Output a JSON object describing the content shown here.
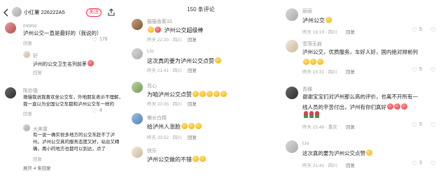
{
  "panel1": {
    "back_icon": "back-arrow-icon",
    "account_name": "小红薯 226222A5",
    "follow_label": "关注",
    "share_icon": "share-icon",
    "comments": [
      {
        "user": "momo",
        "text": "泸州公交一直是最好的（我说的）",
        "meta": "回复",
        "likes": "176"
      },
      {
        "user": "好",
        "text": "泸州的公交卫生名列前茅",
        "meta": "回复",
        "likes": ""
      },
      {
        "user": "陈钞骚",
        "text_lines": [
          "墩慢我说我喜欢坐公交车，外地朋友表示不理解，",
          "我一直以为全国公交车都和泸州公交车一样的"
        ],
        "meta": "回复",
        "likes": "4"
      },
      {
        "user": "大美童",
        "text_lines": [
          "有一说一确实很多地方的公交车赶不了泸",
          "州。泸州公交真的服务态度又好，站台又精",
          "确，再小的地方也都可以到达，点了"
        ],
        "meta": "回复",
        "likes": ""
      }
    ],
    "expand_label": "展开 4 条回复"
  },
  "panel2": {
    "header": "150 条评论",
    "comments": [
      {
        "user": "猫猫香蕉33",
        "text": "泸州公交超级棒",
        "meta": "昨天 22:20 · 四川",
        "reply": "回复"
      },
      {
        "user": "Liu",
        "text": "这次真的要为泸州公交点赞",
        "meta": "昨天 21:41 · 四川",
        "reply": "回复"
      },
      {
        "user": "兑心",
        "text": "为咱泸州公交点赞",
        "meta": "昨天 20:35 · 四川",
        "reply": "回复"
      },
      {
        "user": "懒长白精",
        "text": "给泸州人涨脸",
        "meta": "昨天 20:52 · 四川",
        "reply": "回复"
      },
      {
        "user": "快乐",
        "text": "泸州公交做的不错",
        "meta": "",
        "reply": ""
      }
    ]
  },
  "panel3": {
    "comments": [
      {
        "user": "丽丽",
        "text": "泸州公交",
        "meta": "昨天 19:19 · 四川",
        "reply": "回复",
        "likes": "5"
      },
      {
        "user": "雪落无痕",
        "text": "泸州公交，优质服务，车好人好，国内绝对排前列",
        "meta": "昨天 15:31 · 四川",
        "reply": "回复",
        "likes": "5"
      },
      {
        "user": "青稞",
        "text_lines": [
          "谢谢宝宝们对泸州那么高的评价，也离不开所有一",
          "线人员的辛苦付出，泸州有你们真好"
        ],
        "meta": "昨天 15:48 · 重庆",
        "reply": "回复",
        "likes": "5"
      },
      {
        "user": "Liu",
        "text": "这次真的要为泸州公交点赞",
        "meta": "昨天 21:41 · 四川",
        "reply": "回复",
        "likes": "3"
      }
    ]
  }
}
